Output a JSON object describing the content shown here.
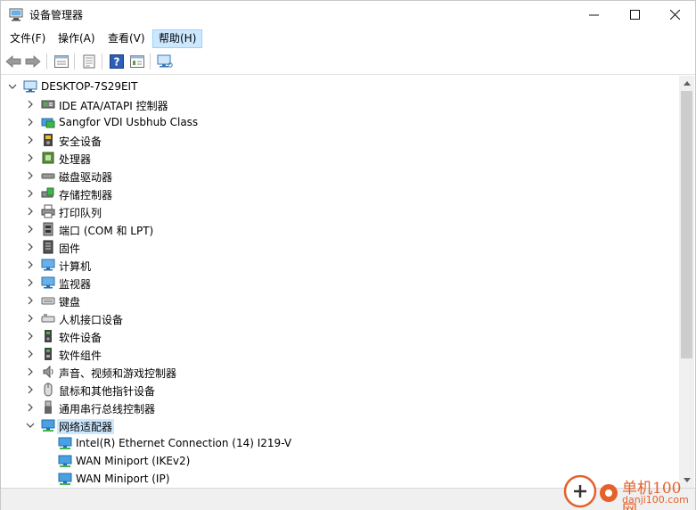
{
  "window": {
    "title": "设备管理器",
    "controls": {
      "minimize": "—",
      "maximize": "☐",
      "close": "✕"
    }
  },
  "menu": {
    "items": [
      {
        "label": "文件(F)",
        "active": false
      },
      {
        "label": "操作(A)",
        "active": false
      },
      {
        "label": "查看(V)",
        "active": false
      },
      {
        "label": "帮助(H)",
        "active": true
      }
    ]
  },
  "toolbar": {
    "buttons": [
      "back-arrow-icon",
      "forward-arrow-icon",
      "properties-icon",
      "refresh-icon",
      "help-icon",
      "view-icon",
      "monitor-icon"
    ]
  },
  "tree": {
    "root": "DESKTOP-7S29EIT",
    "categories": [
      {
        "label": "IDE ATA/ATAPI 控制器",
        "icon": "ide-controller-icon"
      },
      {
        "label": "Sangfor VDI Usbhub Class",
        "icon": "usb-hub-icon"
      },
      {
        "label": "安全设备",
        "icon": "security-device-icon"
      },
      {
        "label": "处理器",
        "icon": "processor-icon"
      },
      {
        "label": "磁盘驱动器",
        "icon": "disk-drive-icon"
      },
      {
        "label": "存储控制器",
        "icon": "storage-controller-icon"
      },
      {
        "label": "打印队列",
        "icon": "printer-icon"
      },
      {
        "label": "端口 (COM 和 LPT)",
        "icon": "port-icon"
      },
      {
        "label": "固件",
        "icon": "firmware-icon"
      },
      {
        "label": "计算机",
        "icon": "computer-icon"
      },
      {
        "label": "监视器",
        "icon": "monitor-icon"
      },
      {
        "label": "键盘",
        "icon": "keyboard-icon"
      },
      {
        "label": "人机接口设备",
        "icon": "hid-icon"
      },
      {
        "label": "软件设备",
        "icon": "software-device-icon"
      },
      {
        "label": "软件组件",
        "icon": "software-component-icon"
      },
      {
        "label": "声音、视频和游戏控制器",
        "icon": "speaker-icon"
      },
      {
        "label": "鼠标和其他指针设备",
        "icon": "mouse-icon"
      },
      {
        "label": "通用串行总线控制器",
        "icon": "usb-icon"
      },
      {
        "label": "网络适配器",
        "icon": "network-adapter-icon",
        "expanded": true,
        "selected": true
      }
    ],
    "network_children": [
      "Intel(R) Ethernet Connection (14) I219-V",
      "WAN Miniport (IKEv2)",
      "WAN Miniport (IP)"
    ]
  },
  "watermark": {
    "name": "单机100网",
    "url": "danji100.com"
  },
  "colors": {
    "selection": "#cce8ff",
    "menu_active_border": "#99d1ff",
    "watermark": "#e5602b",
    "network_icon": "#1e7fd0"
  }
}
